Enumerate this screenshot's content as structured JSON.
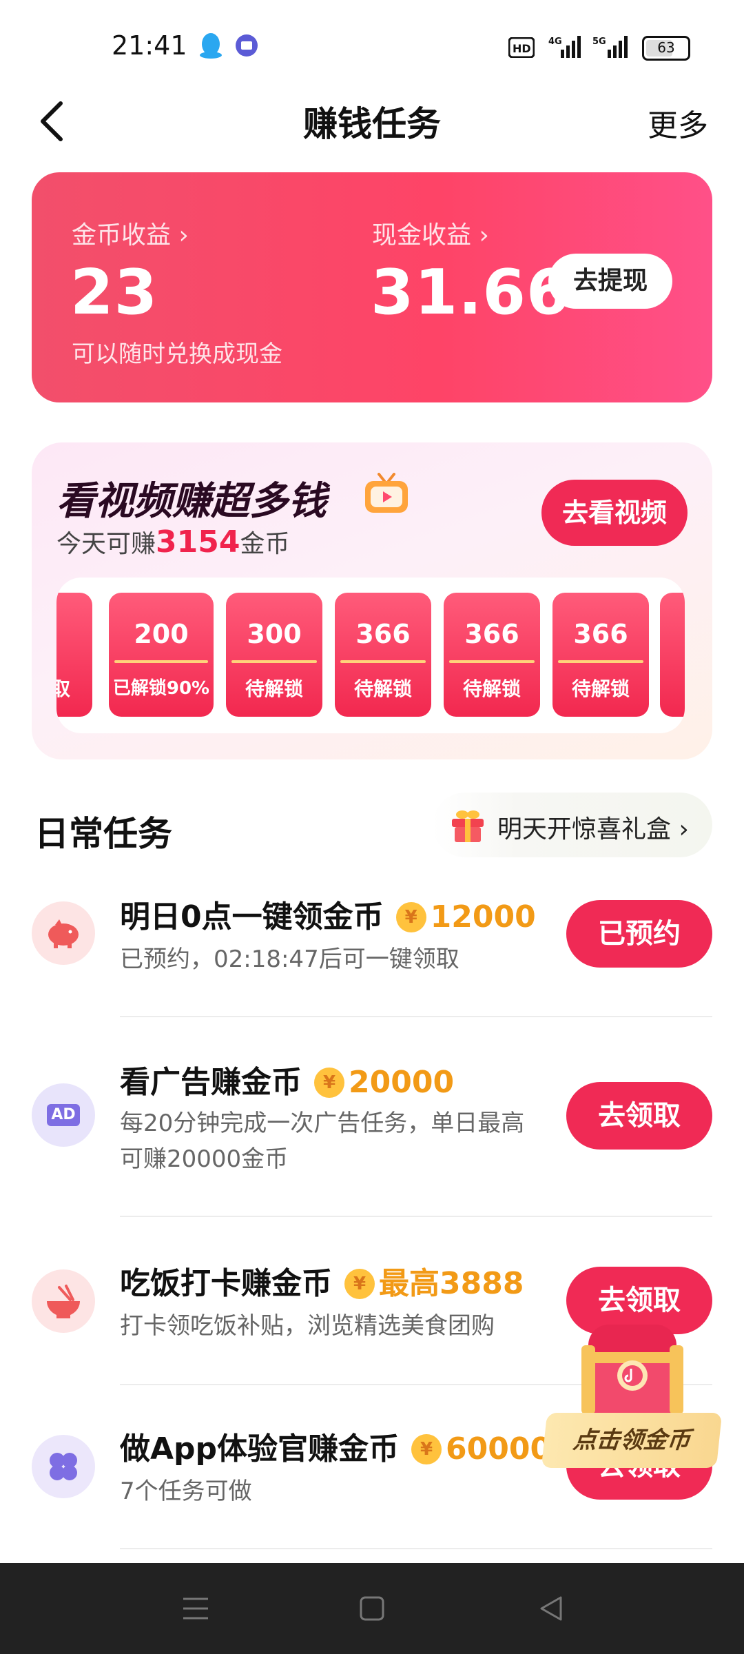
{
  "status_bar": {
    "time": "21:41",
    "battery": "63",
    "network_labels": [
      "HD",
      "4G",
      "5G"
    ]
  },
  "nav": {
    "title": "赚钱任务",
    "more_label": "更多"
  },
  "earnings": {
    "coin_label": "金币收益 ›",
    "coin_value": "23",
    "coin_sub": "可以随时兑换成现金",
    "cash_label": "现金收益 ›",
    "cash_value": "31.66",
    "withdraw_label": "去提现"
  },
  "video": {
    "title": "看视频赚超多钱",
    "sub_prefix": "今天可赚",
    "sub_amount": "3154",
    "sub_suffix": "金币",
    "watch_label": "去看视频",
    "partial_tile_text": "取",
    "tiles": [
      {
        "amount": "200",
        "status": "已解锁90%"
      },
      {
        "amount": "300",
        "status": "待解锁"
      },
      {
        "amount": "366",
        "status": "待解锁"
      },
      {
        "amount": "366",
        "status": "待解锁"
      },
      {
        "amount": "366",
        "status": "待解锁"
      }
    ]
  },
  "daily": {
    "title": "日常任务",
    "gift_label": "明天开惊喜礼盒 ›",
    "tasks": [
      {
        "icon": "piggy-bank-icon",
        "title": "明日0点一键领金币",
        "reward": "12000",
        "desc": "已预约，02:18:47后可一键领取",
        "button": "已预约"
      },
      {
        "icon": "ad-icon",
        "icon_text": "AD",
        "title": "看广告赚金币",
        "reward": "20000",
        "desc": "每20分钟完成一次广告任务，单日最高可赚20000金币",
        "button": "去领取"
      },
      {
        "icon": "rice-bowl-icon",
        "title": "吃饭打卡赚金币",
        "reward": "最高3888",
        "desc": "打卡领吃饭补贴，浏览精选美食团购",
        "button": "去领取"
      },
      {
        "icon": "clover-icon",
        "title": "做App体验官赚金币",
        "reward": "60000",
        "desc": "7个任务可做",
        "button": "去领取"
      }
    ]
  },
  "coin_symbol": "¥",
  "float": {
    "label": "点击领金币"
  },
  "colors": {
    "accent": "#f02a55",
    "reward": "#f29a16",
    "card": "#fe4467"
  }
}
